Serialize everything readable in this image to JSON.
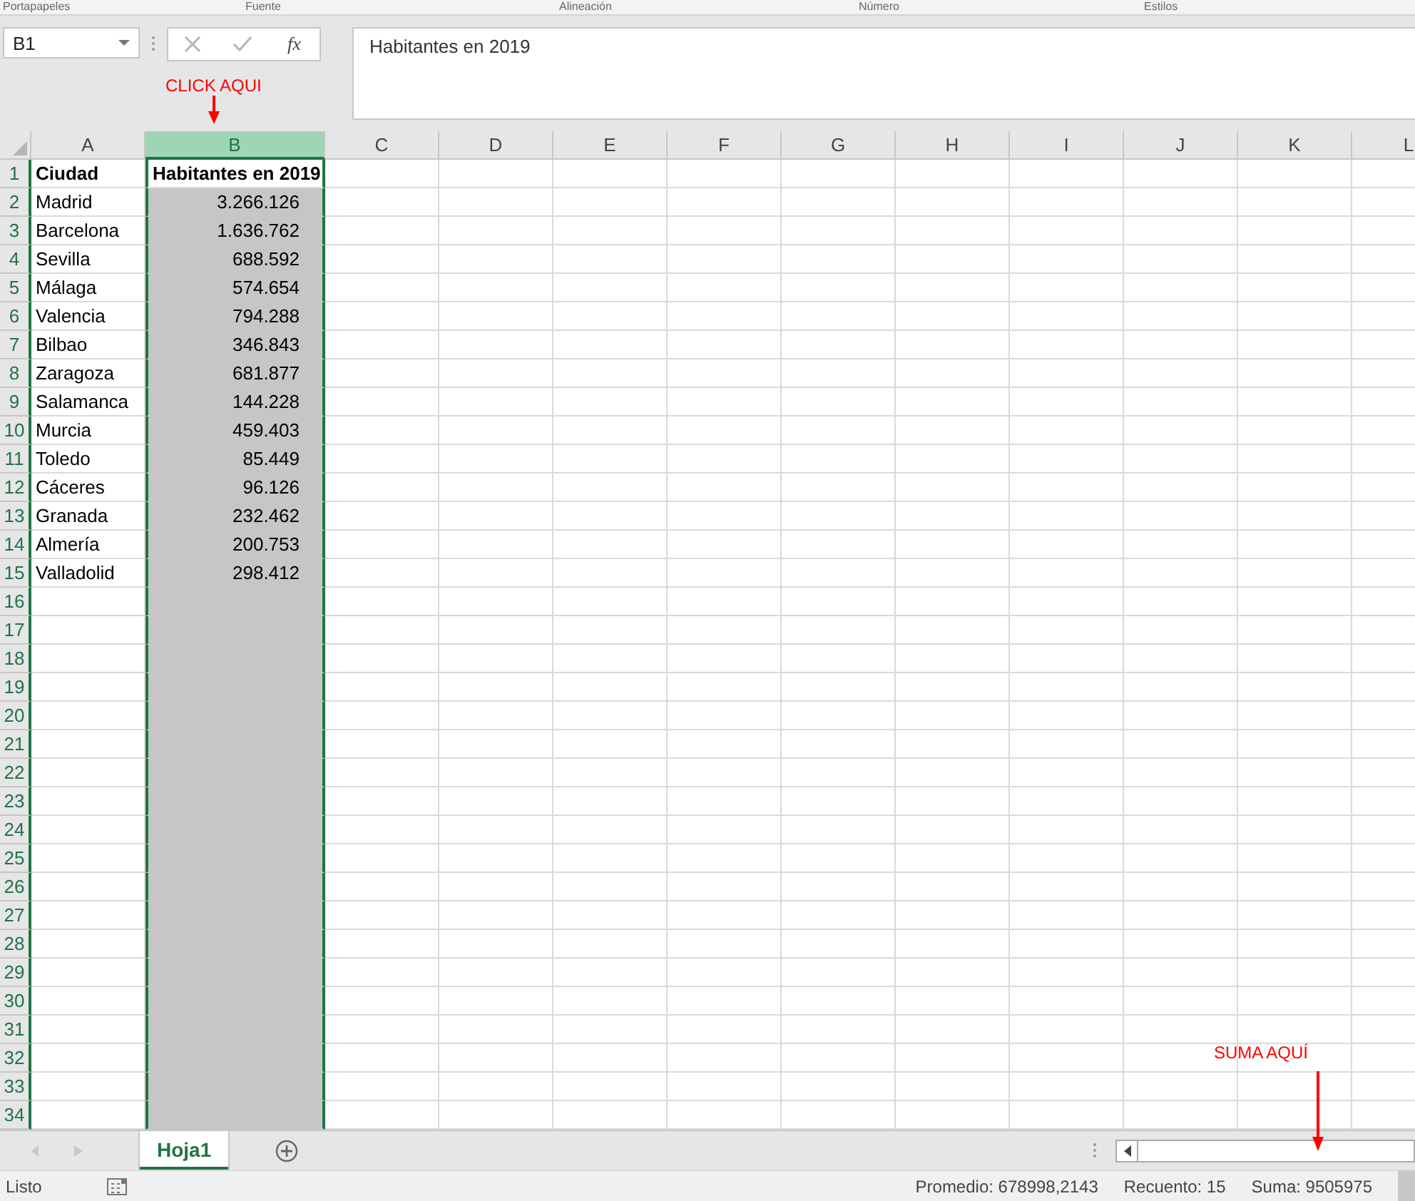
{
  "ribbon_groups": [
    "Portapapeles",
    "Fuente",
    "Alineación",
    "Número",
    "Estilos"
  ],
  "name_box": {
    "value": "B1"
  },
  "formula_bar": {
    "function_label": "fx",
    "value": "Habitantes en 2019"
  },
  "columns": [
    {
      "label": "A",
      "selected": false
    },
    {
      "label": "B",
      "selected": true
    },
    {
      "label": "C",
      "selected": false
    },
    {
      "label": "D",
      "selected": false
    },
    {
      "label": "E",
      "selected": false
    },
    {
      "label": "F",
      "selected": false
    },
    {
      "label": "G",
      "selected": false
    },
    {
      "label": "H",
      "selected": false
    },
    {
      "label": "I",
      "selected": false
    },
    {
      "label": "J",
      "selected": false
    },
    {
      "label": "K",
      "selected": false
    },
    {
      "label": "L",
      "selected": false
    }
  ],
  "rows": [
    {
      "number": "1",
      "kind": "header",
      "active": true,
      "cells": [
        "Ciudad",
        "Habitantes en 2019"
      ]
    },
    {
      "number": "2",
      "kind": "data",
      "active": false,
      "cells": [
        "Madrid",
        "3.266.126"
      ]
    },
    {
      "number": "3",
      "kind": "data",
      "active": false,
      "cells": [
        "Barcelona",
        "1.636.762"
      ]
    },
    {
      "number": "4",
      "kind": "data",
      "active": false,
      "cells": [
        "Sevilla",
        "688.592"
      ]
    },
    {
      "number": "5",
      "kind": "data",
      "active": false,
      "cells": [
        "Málaga",
        "574.654"
      ]
    },
    {
      "number": "6",
      "kind": "data",
      "active": false,
      "cells": [
        "Valencia",
        "794.288"
      ]
    },
    {
      "number": "7",
      "kind": "data",
      "active": false,
      "cells": [
        "Bilbao",
        "346.843"
      ]
    },
    {
      "number": "8",
      "kind": "data",
      "active": false,
      "cells": [
        "Zaragoza",
        "681.877"
      ]
    },
    {
      "number": "9",
      "kind": "data",
      "active": false,
      "cells": [
        "Salamanca",
        "144.228"
      ]
    },
    {
      "number": "10",
      "kind": "data",
      "active": false,
      "cells": [
        "Murcia",
        "459.403"
      ]
    },
    {
      "number": "11",
      "kind": "data",
      "active": false,
      "cells": [
        "Toledo",
        "85.449"
      ]
    },
    {
      "number": "12",
      "kind": "data",
      "active": false,
      "cells": [
        "Cáceres",
        "96.126"
      ]
    },
    {
      "number": "13",
      "kind": "data",
      "active": false,
      "cells": [
        "Granada",
        "232.462"
      ]
    },
    {
      "number": "14",
      "kind": "data",
      "active": false,
      "cells": [
        "Almería",
        "200.753"
      ]
    },
    {
      "number": "15",
      "kind": "data",
      "active": false,
      "cells": [
        "Valladolid",
        "298.412"
      ]
    },
    {
      "number": "16",
      "kind": "data",
      "active": false,
      "cells": []
    },
    {
      "number": "17",
      "kind": "data",
      "active": false,
      "cells": []
    },
    {
      "number": "18",
      "kind": "data",
      "active": false,
      "cells": []
    },
    {
      "number": "19",
      "kind": "data",
      "active": false,
      "cells": []
    },
    {
      "number": "20",
      "kind": "data",
      "active": false,
      "cells": []
    },
    {
      "number": "21",
      "kind": "data",
      "active": false,
      "cells": []
    },
    {
      "number": "22",
      "kind": "data",
      "active": false,
      "cells": []
    },
    {
      "number": "23",
      "kind": "data",
      "active": false,
      "cells": []
    },
    {
      "number": "24",
      "kind": "data",
      "active": false,
      "cells": []
    },
    {
      "number": "25",
      "kind": "data",
      "active": false,
      "cells": []
    },
    {
      "number": "26",
      "kind": "data",
      "active": false,
      "cells": []
    },
    {
      "number": "27",
      "kind": "data",
      "active": false,
      "cells": []
    },
    {
      "number": "28",
      "kind": "data",
      "active": false,
      "cells": []
    },
    {
      "number": "29",
      "kind": "data",
      "active": false,
      "cells": []
    },
    {
      "number": "30",
      "kind": "data",
      "active": false,
      "cells": []
    },
    {
      "number": "31",
      "kind": "data",
      "active": false,
      "cells": []
    },
    {
      "number": "32",
      "kind": "data",
      "active": false,
      "cells": []
    },
    {
      "number": "33",
      "kind": "data",
      "active": false,
      "cells": []
    },
    {
      "number": "34",
      "kind": "data",
      "active": false,
      "cells": []
    }
  ],
  "sheet_tabs": [
    {
      "label": "Hoja1",
      "selected": true
    }
  ],
  "status_bar": {
    "mode": "Listo",
    "average": "Promedio: 678998,2143",
    "count": "Recuento: 15",
    "sum": "Suma: 9505975"
  },
  "annotations": [
    {
      "text": "CLICK AQUI"
    },
    {
      "text": "SUMA AQUÍ"
    }
  ]
}
